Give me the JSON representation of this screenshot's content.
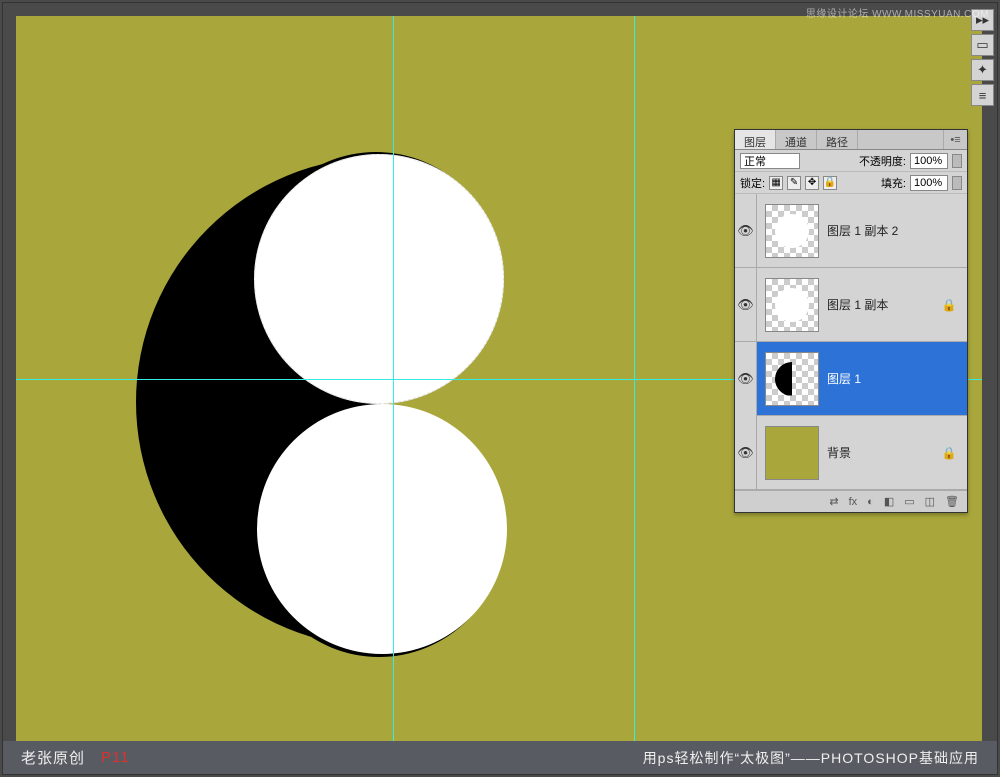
{
  "watermark": "思缘设计论坛  WWW.MISSYUAN.COM",
  "toolbar_right": {
    "items": [
      "▸▸",
      "▭",
      "✦",
      "≡"
    ]
  },
  "panel": {
    "tabs": {
      "layers": "图层",
      "channels": "通道",
      "paths": "路径"
    },
    "close": "•≡",
    "row1": {
      "blend": "正常",
      "opacity_label": "不透明度:",
      "opacity_value": "100%"
    },
    "row2": {
      "lock_label": "锁定:",
      "fill_label": "填充:",
      "fill_value": "100%"
    },
    "layers": [
      {
        "name": "图层 1 副本 2",
        "thumb": "white",
        "locked": false
      },
      {
        "name": "图层 1 副本",
        "thumb": "white",
        "locked": true
      },
      {
        "name": "图层 1",
        "thumb": "half",
        "locked": false,
        "selected": true
      },
      {
        "name": "背景",
        "thumb": "olive",
        "locked": true
      }
    ],
    "bottom_icons": [
      "⇄",
      "fx",
      "◐",
      "◧",
      "▭",
      "◫",
      "🗑"
    ]
  },
  "footer": {
    "author": "老张原创",
    "page": "P11",
    "title": "用ps轻松制作“太极图”——PHOTOSHOP基础应用"
  }
}
